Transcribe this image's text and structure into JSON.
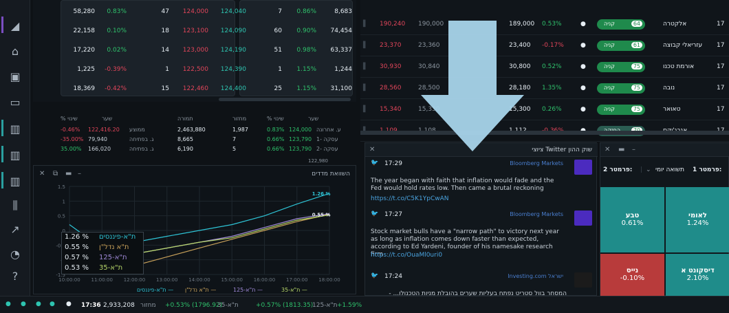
{
  "top_table": {
    "rows": [
      {
        "c1": "58,280",
        "c2": "0.83%",
        "c3": "47",
        "c4": "124,000",
        "c5": "124,040",
        "c6": "7",
        "c7": "0.86%",
        "c8": "8,683"
      },
      {
        "c1": "22,158",
        "c2": "0.10%",
        "c3": "18",
        "c4": "123,100",
        "c5": "124,090",
        "c6": "60",
        "c7": "0.90%",
        "c8": "74,454"
      },
      {
        "c1": "17,220",
        "c2": "0.02%",
        "c3": "14",
        "c4": "123,000",
        "c5": "124,190",
        "c6": "51",
        "c7": "0.98%",
        "c8": "63,337"
      },
      {
        "c1": "1,225",
        "c2": "-0.39%",
        "c3": "1",
        "c4": "122,500",
        "c5": "124,390",
        "c6": "1",
        "c7": "1.15%",
        "c8": "1,244"
      },
      {
        "c1": "18,369",
        "c2": "-0.42%",
        "c3": "15",
        "c4": "122,460",
        "c5": "124,400",
        "c6": "25",
        "c7": "1.15%",
        "c8": "31,100"
      }
    ]
  },
  "summary": {
    "headers": {
      "h1": "% שינוי",
      "h2": "שער",
      "h3": "תמורה",
      "h4": "מחזור",
      "h5": "% שינוי",
      "h6": "שער"
    },
    "left": [
      {
        "chg": "-0.46%",
        "price": "122,416.20",
        "label": "ממוצע"
      },
      {
        "chg": "-35.00%",
        "price": "79,940",
        "label": "ג. בפתיחה"
      },
      {
        "chg": "35.00%",
        "price": "166,020",
        "label": "ג. בפתיחה"
      }
    ],
    "right": [
      {
        "value": "2,463,880",
        "vol": "1,987",
        "chg": "0.83%",
        "price": "124,000",
        "label": "ע. אחרונה"
      },
      {
        "value": "8,665",
        "vol": "7",
        "chg": "0.66%",
        "price": "123,790",
        "label": "עסקה -1"
      },
      {
        "value": "6,190",
        "vol": "5",
        "chg": "0.66%",
        "price": "123,790",
        "label": "עסקה -2"
      }
    ],
    "cut_row": "122,980"
  },
  "chart": {
    "title": "השוואת מדדים",
    "legend": [
      {
        "value": "1.26 %",
        "name": "ת\"א-פיננסים",
        "color": "#2ec4d6"
      },
      {
        "value": "0.55 %",
        "name": "ת\"א נדל\"ן",
        "color": "#c8a15a"
      },
      {
        "value": "0.57 %",
        "name": "ת\"א-125",
        "color": "#a08ad8"
      },
      {
        "value": "0.53 %",
        "name": "ת\"א-35",
        "color": "#b8d86a"
      }
    ],
    "end_labels": {
      "top": "1.26 %",
      "mid": "0.55 %"
    },
    "bottom_legend": [
      {
        "name": "ת\"א-פיננסים —",
        "color": "#2ec4d6"
      },
      {
        "name": "ת\"א נדל\"ן —",
        "color": "#c8a15a"
      },
      {
        "name": "ת\"א-125 —",
        "color": "#a08ad8"
      },
      {
        "name": "ת\"א-35 —",
        "color": "#b8d86a"
      }
    ]
  },
  "chart_data": {
    "type": "line",
    "x": [
      "10:00:00",
      "11:00:00",
      "12:00:00",
      "13:00:00",
      "14:00:00",
      "15:00:00",
      "16:00:00",
      "17:00:00",
      "18:00:00"
    ],
    "ylim": [
      -1.5,
      1.5
    ],
    "yticks": [
      "1.5",
      "1",
      "0.5",
      "0",
      "-0.5",
      "-1",
      "-1.5"
    ],
    "series": [
      {
        "name": "ת\"א-פיננסים",
        "color": "#2ec4d6",
        "values": [
          0.2,
          -0.6,
          -0.4,
          -0.2,
          0.0,
          0.2,
          0.5,
          0.9,
          1.26
        ]
      },
      {
        "name": "ת\"א נדל\"ן",
        "color": "#c8a15a",
        "values": [
          -0.3,
          -0.9,
          -1.2,
          -0.9,
          -0.6,
          -0.3,
          0.0,
          0.3,
          0.55
        ]
      },
      {
        "name": "ת\"א-125",
        "color": "#a08ad8",
        "values": [
          -0.3,
          -1.0,
          -0.8,
          -0.6,
          -0.4,
          -0.2,
          0.1,
          0.4,
          0.57
        ]
      },
      {
        "name": "ת\"א-35",
        "color": "#b8d86a",
        "values": [
          -0.3,
          -1.0,
          -0.8,
          -0.6,
          -0.4,
          -0.25,
          0.05,
          0.35,
          0.53
        ]
      }
    ]
  },
  "status": {
    "time": "17:36",
    "volume": "2,933,208",
    "volume_label": "מחזור",
    "i1_chg": "+0.53% (1796.92)",
    "i1_name": "ת\"א-35",
    "i2_chg": "+0.57% (1813.35)",
    "i2_name": "ת\"א-125",
    "i3_chg": "+1.59%"
  },
  "right_table": {
    "rows": [
      {
        "a": "190,240",
        "b": "190,000",
        "last": "189,000",
        "chg": "0.53%",
        "pill": "קניה",
        "num": "64",
        "name": "אלקטרה",
        "q": "17"
      },
      {
        "a": "23,370",
        "b": "23,360",
        "last": "23,400",
        "chg": "-0.17%",
        "pill": "קניה",
        "num": "61",
        "name": "עזריאלי קבוצה",
        "q": "17"
      },
      {
        "a": "30,930",
        "b": "30,840",
        "last": "30,800",
        "chg": "0.52%",
        "pill": "קניה",
        "num": "75",
        "name": "אורמת טכנו",
        "q": "17"
      },
      {
        "a": "28,560",
        "b": "28,500",
        "last": "28,180",
        "chg": "1.35%",
        "pill": "קניה",
        "num": "75",
        "name": "נובה",
        "q": "17"
      },
      {
        "a": "15,340",
        "b": "15,330",
        "last": "15,300",
        "chg": "0.26%",
        "pill": "קניה",
        "num": "75",
        "name": "טאואר",
        "q": "17"
      },
      {
        "a": "1,109",
        "b": "1,108",
        "last": "1,112",
        "chg": "-0.36%",
        "pill": "החזקה",
        "num": "70",
        "name": "אנרג'יקס",
        "q": "17"
      }
    ]
  },
  "twitter": {
    "title": "ציוצי Twitter שוק ההון",
    "tweets": [
      {
        "time": "17:29",
        "source": "Bloomberg Markets",
        "text": "The year began with faith that inflation would fade and the Fed would hold rates low. Then came a brutal reckoning",
        "link": "https://t.co/C5K1YpCwAN"
      },
      {
        "time": "17:27",
        "source": "Bloomberg Markets",
        "text": "Stock market bulls have a \"narrow path\" to victory next year as long as inflation comes down faster than expected, according to Ed Yardeni, founder of his namesake research firm",
        "link": "https://t.co/OuaMl0uri0"
      },
      {
        "time": "17:24",
        "source": "Investing.com ישראל",
        "text": "המסחר בוול סטריט נפתח בעליות שערים בהובלת מניות הטכנולו... -",
        "link": "https://t.co/Lmf6gajKyo"
      }
    ]
  },
  "heatmap": {
    "param2": "פרמטר 2:",
    "param1_label": "פרמטר 1:",
    "param1_value": "תשואה יומי",
    "tiles": [
      {
        "name": "טבע",
        "value": "0.61%",
        "color": "#1f8c8a"
      },
      {
        "name": "לאומי",
        "value": "1.24%",
        "color": "#1f8c8a"
      },
      {
        "name": "נייס",
        "value": "-0.10%",
        "color": "#b83b3b"
      },
      {
        "name": "דיסקונט א",
        "value": "2.10%",
        "color": "#1f8c8a"
      }
    ]
  },
  "colors": {
    "accent": "#2ec4b0",
    "negative": "#e0455a",
    "positive": "#2fc16b",
    "arrow": "#a8d4ea"
  }
}
